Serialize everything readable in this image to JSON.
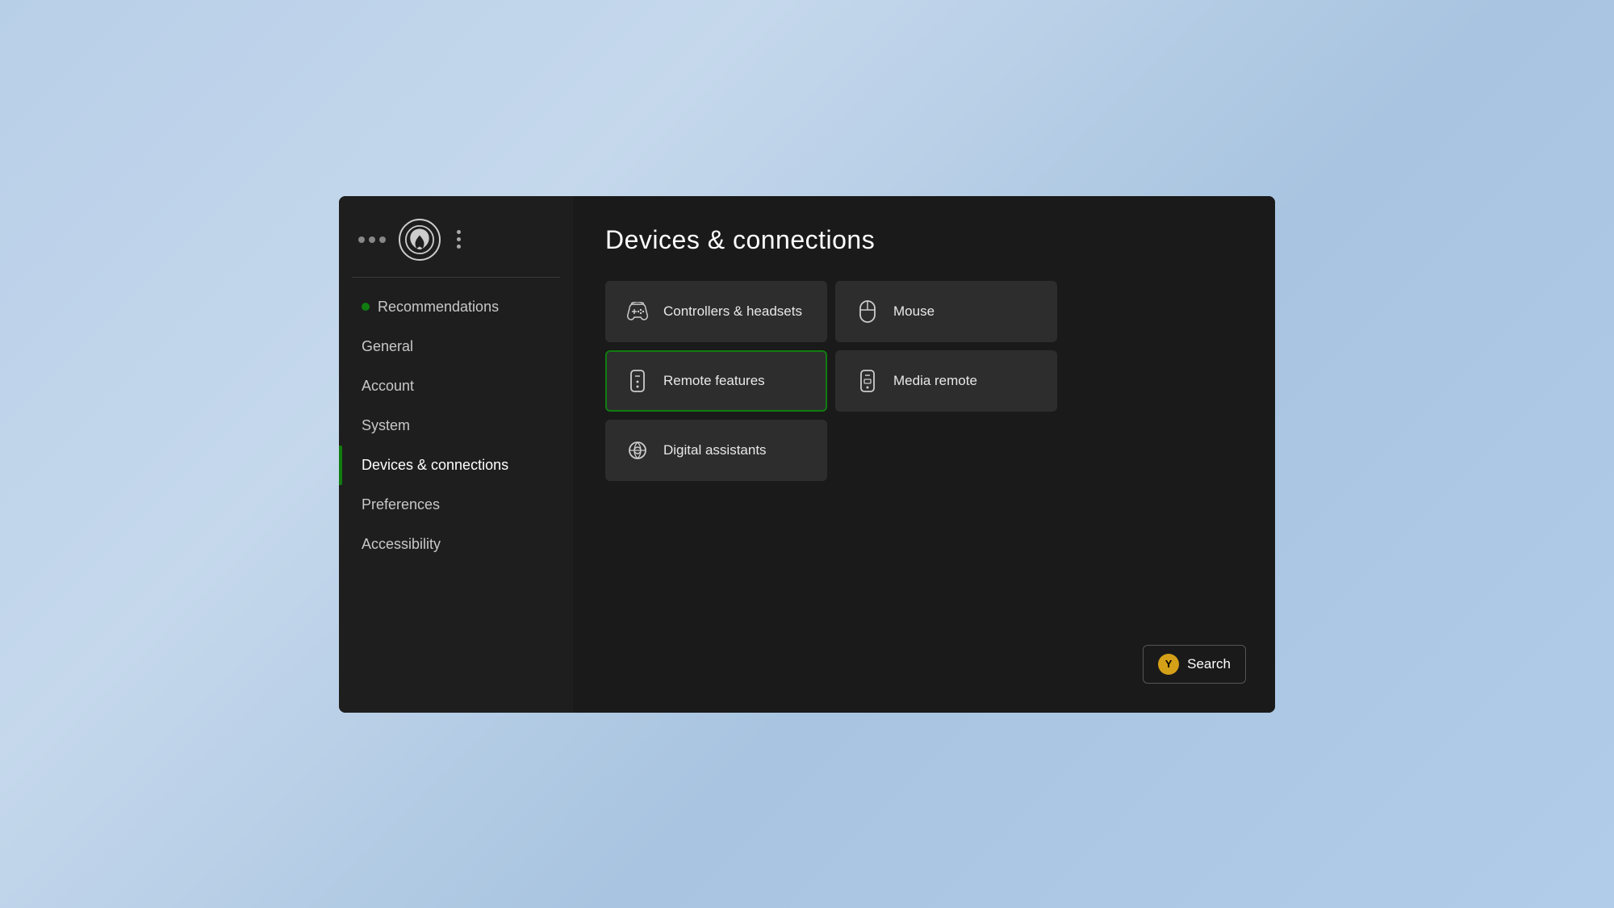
{
  "window": {
    "title": "Devices & connections"
  },
  "sidebar": {
    "logo_alt": "Xbox logo",
    "nav_items": [
      {
        "id": "recommendations",
        "label": "Recommendations",
        "active": false,
        "has_dot": true
      },
      {
        "id": "general",
        "label": "General",
        "active": false,
        "has_dot": false
      },
      {
        "id": "account",
        "label": "Account",
        "active": false,
        "has_dot": false
      },
      {
        "id": "system",
        "label": "System",
        "active": false,
        "has_dot": false
      },
      {
        "id": "devices",
        "label": "Devices & connections",
        "active": true,
        "has_dot": false
      },
      {
        "id": "preferences",
        "label": "Preferences",
        "active": false,
        "has_dot": false
      },
      {
        "id": "accessibility",
        "label": "Accessibility",
        "active": false,
        "has_dot": false
      }
    ]
  },
  "main": {
    "page_title": "Devices & connections",
    "grid_items": [
      {
        "id": "controllers",
        "label": "Controllers & headsets",
        "icon": "controller-icon",
        "selected": false
      },
      {
        "id": "mouse",
        "label": "Mouse",
        "icon": "mouse-icon",
        "selected": false
      },
      {
        "id": "remote-features",
        "label": "Remote features",
        "icon": "remote-icon",
        "selected": true
      },
      {
        "id": "media-remote",
        "label": "Media remote",
        "icon": "media-remote-icon",
        "selected": false
      },
      {
        "id": "digital-assistants",
        "label": "Digital assistants",
        "icon": "assistant-icon",
        "selected": false
      }
    ]
  },
  "search_button": {
    "y_label": "Y",
    "label": "Search"
  }
}
